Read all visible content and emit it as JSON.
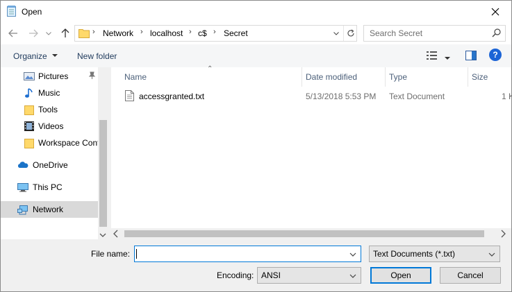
{
  "window": {
    "title": "Open"
  },
  "address": {
    "crumbs": [
      "Network",
      "localhost",
      "c$",
      "Secret"
    ]
  },
  "search": {
    "placeholder": "Search Secret"
  },
  "commands": {
    "organize": "Organize",
    "new_folder": "New folder"
  },
  "nav": {
    "items": [
      {
        "label": "Pictures",
        "icon": "pictures-icon",
        "pinned": true
      },
      {
        "label": "Music",
        "icon": "music-icon"
      },
      {
        "label": "Tools",
        "icon": "folder-icon"
      },
      {
        "label": "Videos",
        "icon": "videos-icon"
      },
      {
        "label": "Workspace Cont",
        "icon": "folder-icon"
      },
      {
        "label": "OneDrive",
        "icon": "onedrive-icon"
      },
      {
        "label": "This PC",
        "icon": "this-pc-icon"
      },
      {
        "label": "Network",
        "icon": "network-icon",
        "selected": true
      }
    ]
  },
  "columns": {
    "name": "Name",
    "date": "Date modified",
    "type": "Type",
    "size": "Size"
  },
  "files": [
    {
      "name": "accessgranted.txt",
      "date": "5/13/2018 5:53 PM",
      "type": "Text Document",
      "size": "1 K"
    }
  ],
  "form": {
    "file_name_label": "File name:",
    "file_name_value": "",
    "file_type": "Text Documents (*.txt)",
    "encoding_label": "Encoding:",
    "encoding": "ANSI",
    "open": "Open",
    "cancel": "Cancel"
  },
  "colors": {
    "accent": "#0078d7",
    "folder": "#ffd96b",
    "help": "#1c64d6"
  }
}
